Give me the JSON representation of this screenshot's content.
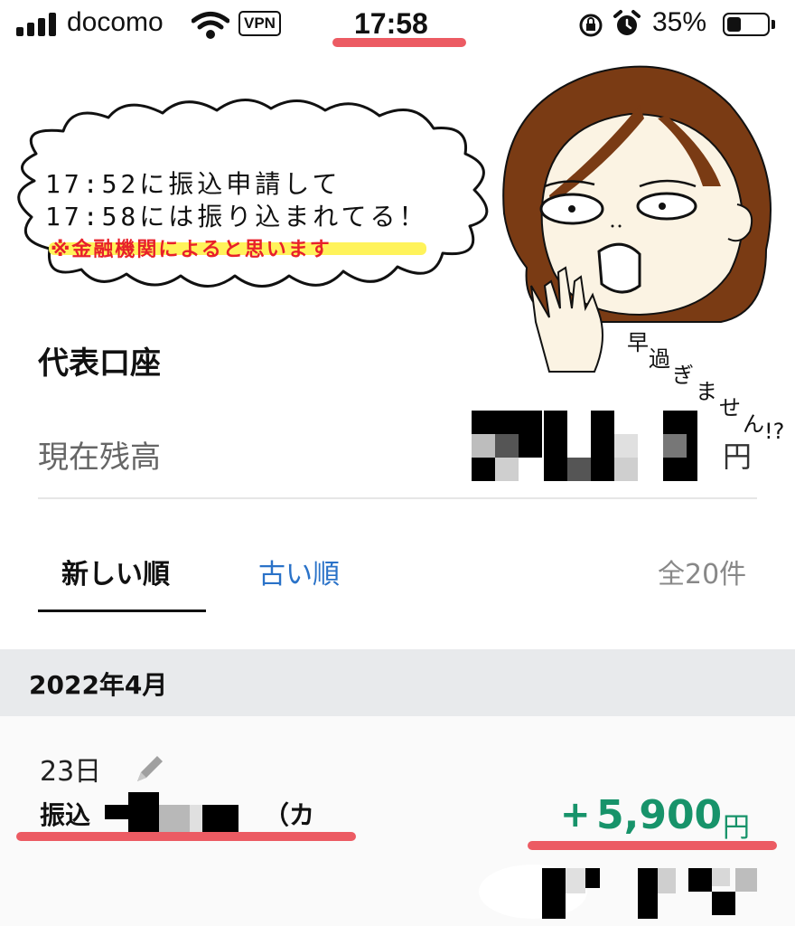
{
  "status_bar": {
    "carrier": "docomo",
    "vpn": "VPN",
    "time": "17:58",
    "battery_percent": "35%",
    "battery_level": 0.35
  },
  "bubble": {
    "line1": "17:52に振込申請して",
    "line2": "17:58には振り込まれてる！",
    "note": "※金融機関によると思います"
  },
  "exclamation": [
    "早",
    "過",
    "ぎ",
    "ま",
    "せ",
    "ん",
    "!?"
  ],
  "account": {
    "title": "代表口座",
    "balance_label": "現在残高",
    "balance_unit": "円"
  },
  "sort_tabs": {
    "newest": "新しい順",
    "oldest": "古い順",
    "total": "全20件"
  },
  "month": "2022年4月",
  "transaction": {
    "day": "23日",
    "name_prefix": "振込",
    "name_suffix": "（カ",
    "sign": "+",
    "amount": "5,900",
    "unit": "円"
  },
  "colors": {
    "accent_green": "#17936a",
    "link_blue": "#2a72c8",
    "highlight_red": "#ec5b63",
    "note_red": "#e8202a",
    "note_yellow": "#fff35a"
  },
  "icons": [
    "signal-icon",
    "wifi-icon",
    "rotation-lock-icon",
    "alarm-icon",
    "battery-icon",
    "pencil-icon"
  ]
}
